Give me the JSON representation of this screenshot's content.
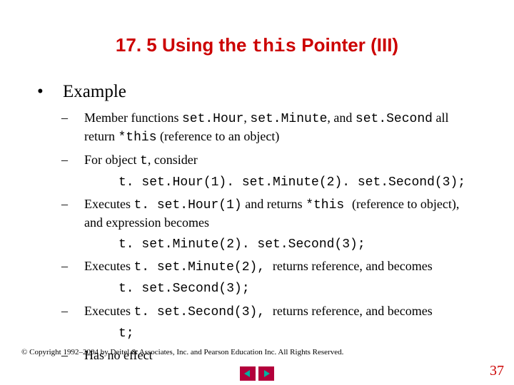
{
  "title": {
    "section": "17. 5 ",
    "pre": " Using the ",
    "code": "this",
    "post": " Pointer (III)"
  },
  "body": {
    "lvl1": "Example",
    "b1": {
      "pre": "Member functions ",
      "c1": "set.Hour",
      "mid1": ", ",
      "c2": "set.Minute",
      "mid2": ", and ",
      "c3": "set.Second",
      "mid3": " all return ",
      "c4": "*this",
      "post": " (reference to an object)"
    },
    "b2": {
      "pre": "For object ",
      "c1": "t",
      "post": ", consider"
    },
    "b2code": "t. set.Hour(1). set.Minute(2). set.Second(3);",
    "b3": {
      "pre": "Executes ",
      "c1": "t. set.Hour(1)",
      "mid1": " and returns ",
      "c2": "*this ",
      "post": " (reference to object), and expression becomes"
    },
    "b3code": "t. set.Minute(2). set.Second(3);",
    "b4": {
      "pre": "Executes ",
      "c1": "t. set.Minute(2), ",
      "post": "returns reference, and becomes"
    },
    "b4code": "t. set.Second(3);",
    "b5": {
      "pre": "Executes ",
      "c1": "t. set.Second(3), ",
      "post": "returns reference, and becomes"
    },
    "b5code": "t;",
    "b6": "Has no effect"
  },
  "copyright": "© Copyright 1992–2004 by Deitel & Associates, Inc. and Pearson Education Inc. All Rights Reserved.",
  "pagenum": "37"
}
